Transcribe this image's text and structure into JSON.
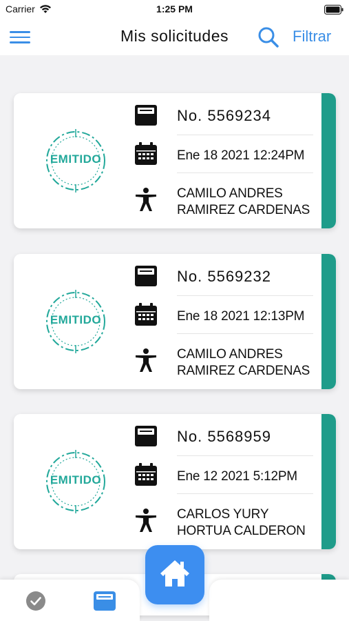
{
  "status_bar": {
    "carrier": "Carrier",
    "time": "1:25 PM"
  },
  "header": {
    "title": "Mis solicitudes",
    "filter_label": "Filtrar"
  },
  "requests": [
    {
      "stamp": "EMITIDO",
      "number": "No. 5569234",
      "date": "Ene 18 2021 12:24PM",
      "name_line1": "CAMILO ANDRES",
      "name_line2": "RAMIREZ CARDENAS"
    },
    {
      "stamp": "EMITIDO",
      "number": "No. 5569232",
      "date": "Ene 18 2021 12:13PM",
      "name_line1": "CAMILO ANDRES",
      "name_line2": "RAMIREZ CARDENAS"
    },
    {
      "stamp": "EMITIDO",
      "number": "No. 5568959",
      "date": "Ene 12 2021 5:12PM",
      "name_line1": "CARLOS YURY",
      "name_line2": "HORTUA CALDERON"
    }
  ],
  "colors": {
    "accent": "#1f9c8a",
    "stamp": "#22a89a",
    "brand_blue": "#3a8ee6",
    "home_button": "#3d8ef0"
  },
  "icons": {
    "menu": "hamburger-menu-icon",
    "search": "search-icon",
    "number": "inbox-tray-icon",
    "date": "calendar-icon",
    "person": "person-icon",
    "tab_done": "check-circle-icon",
    "tab_requests": "inbox-tray-icon",
    "home": "home-icon"
  }
}
